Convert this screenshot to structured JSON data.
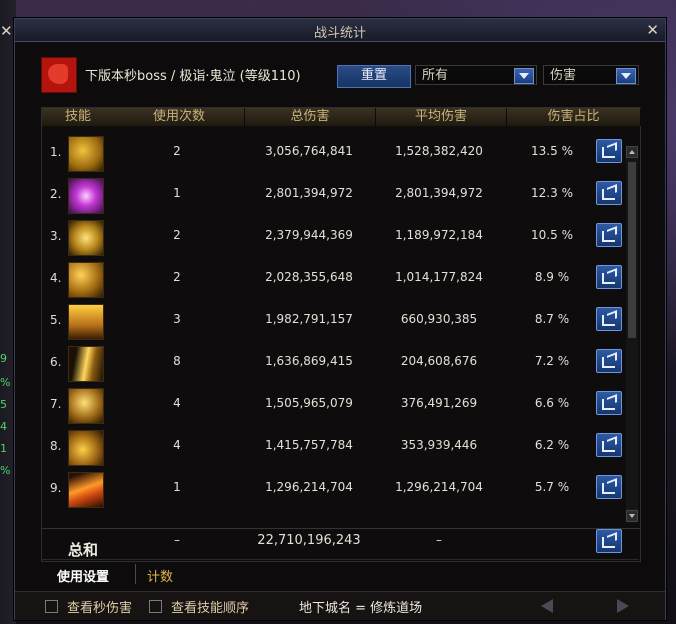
{
  "window": {
    "title": "战斗统计",
    "boss_label": "下版本秒boss / 极诣·鬼泣 (等级110)",
    "reset_button": "重置",
    "filter_select": "所有",
    "metric_select": "伤害"
  },
  "table": {
    "headers": [
      "技能",
      "使用次数",
      "总伤害",
      "平均伤害",
      "伤害占比"
    ],
    "rows": [
      {
        "num": "1.",
        "uses": "2",
        "total": "3,056,764,841",
        "avg": "1,528,382,420",
        "pct": "13.5 %"
      },
      {
        "num": "2.",
        "uses": "1",
        "total": "2,801,394,972",
        "avg": "2,801,394,972",
        "pct": "12.3 %"
      },
      {
        "num": "3.",
        "uses": "2",
        "total": "2,379,944,369",
        "avg": "1,189,972,184",
        "pct": "10.5 %"
      },
      {
        "num": "4.",
        "uses": "2",
        "total": "2,028,355,648",
        "avg": "1,014,177,824",
        "pct": "8.9 %"
      },
      {
        "num": "5.",
        "uses": "3",
        "total": "1,982,791,157",
        "avg": "660,930,385",
        "pct": "8.7 %"
      },
      {
        "num": "6.",
        "uses": "8",
        "total": "1,636,869,415",
        "avg": "204,608,676",
        "pct": "7.2 %"
      },
      {
        "num": "7.",
        "uses": "4",
        "total": "1,505,965,079",
        "avg": "376,491,269",
        "pct": "6.6 %"
      },
      {
        "num": "8.",
        "uses": "4",
        "total": "1,415,757,784",
        "avg": "353,939,446",
        "pct": "6.2 %"
      },
      {
        "num": "9.",
        "uses": "1",
        "total": "1,296,214,704",
        "avg": "1,296,214,704",
        "pct": "5.7 %"
      }
    ],
    "total_row": {
      "label": "总和",
      "uses": "–",
      "total": "22,710,196,243",
      "avg": "–"
    }
  },
  "tabs": {
    "active": "使用设置",
    "inactive": "计数"
  },
  "bottom": {
    "check1": "查看秒伤害",
    "check2": "查看技能顺序",
    "dungeon": "地下城名 = 修炼道场"
  },
  "left_strip_numbers": [
    "9",
    "%",
    "5",
    "4",
    "1",
    "%"
  ],
  "colors": {
    "accent_blue": "#2d5aa3",
    "header_gold": "#c9b27a",
    "tab_gold": "#e0b64a"
  }
}
